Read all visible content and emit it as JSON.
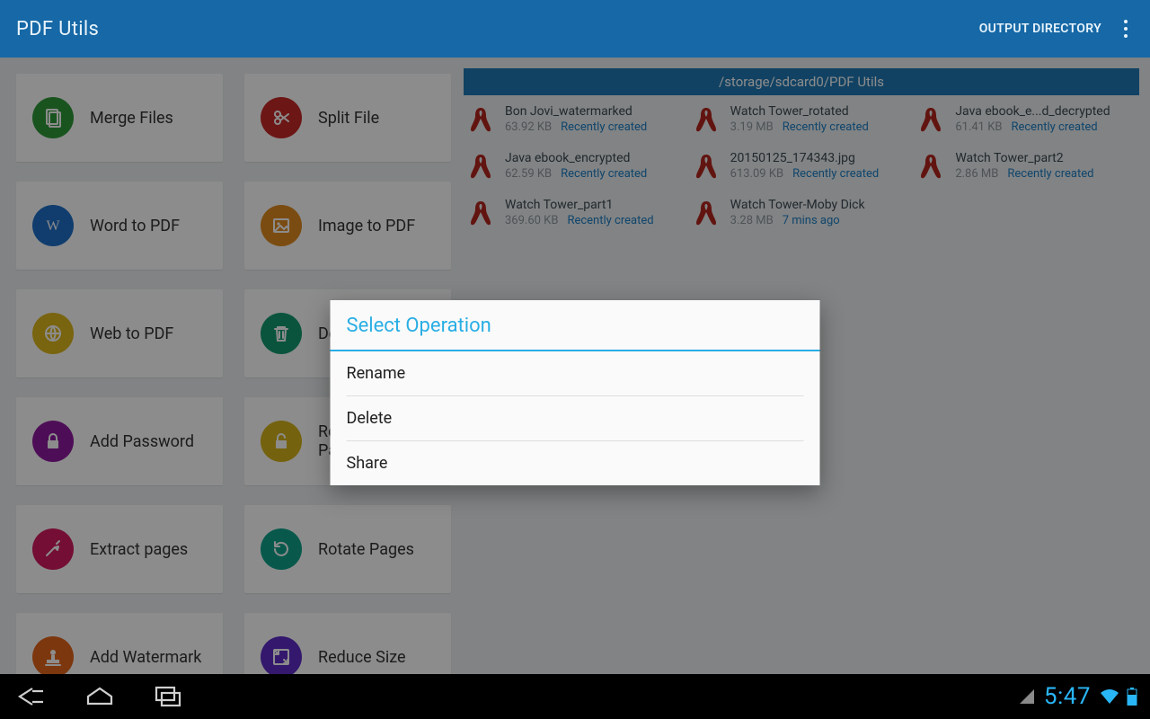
{
  "app": {
    "title": "PDF Utils",
    "output_dir_label": "OUTPUT DIRECTORY"
  },
  "tools": [
    {
      "label": "Merge Files",
      "icon": "merge",
      "color": "#2e9a3a"
    },
    {
      "label": "Split File",
      "icon": "split",
      "color": "#c62828"
    },
    {
      "label": "Word to PDF",
      "icon": "word",
      "color": "#1e6fc9"
    },
    {
      "label": "Image to PDF",
      "icon": "image",
      "color": "#e18a1f"
    },
    {
      "label": "Web to PDF",
      "icon": "globe",
      "color": "#ddb71c"
    },
    {
      "label": "Delete Pages",
      "icon": "trash",
      "color": "#139a6f"
    },
    {
      "label": "Add Password",
      "icon": "lock",
      "color": "#8e1a9e"
    },
    {
      "label": "Remove Password",
      "icon": "unlock",
      "color": "#d6b21a"
    },
    {
      "label": "Extract pages",
      "icon": "extract",
      "color": "#d31a5f"
    },
    {
      "label": "Rotate Pages",
      "icon": "rotate",
      "color": "#0fa38a"
    },
    {
      "label": "Add Watermark",
      "icon": "stamp",
      "color": "#e3651a"
    },
    {
      "label": "Reduce Size",
      "icon": "shrink",
      "color": "#5d2dc6"
    }
  ],
  "output": {
    "path": "/storage/sdcard0/PDF Utils",
    "files": [
      {
        "name": "Bon Jovi_watermarked",
        "size": "63.92 KB",
        "status": "Recently created"
      },
      {
        "name": "Watch Tower_rotated",
        "size": "3.19 MB",
        "status": "Recently created"
      },
      {
        "name": "Java ebook_e...d_decrypted",
        "size": "61.41 KB",
        "status": "Recently created"
      },
      {
        "name": "Java ebook_encrypted",
        "size": "62.59 KB",
        "status": "Recently created"
      },
      {
        "name": "20150125_174343.jpg",
        "size": "613.09 KB",
        "status": "Recently created"
      },
      {
        "name": "Watch Tower_part2",
        "size": "2.86 MB",
        "status": "Recently created"
      },
      {
        "name": "Watch Tower_part1",
        "size": "369.60 KB",
        "status": "Recently created"
      },
      {
        "name": "Watch Tower-Moby Dick",
        "size": "3.28 MB",
        "status": "7 mins ago"
      }
    ]
  },
  "dialog": {
    "title": "Select Operation",
    "items": [
      "Rename",
      "Delete",
      "Share"
    ]
  },
  "navbar": {
    "clock": "5:47"
  }
}
